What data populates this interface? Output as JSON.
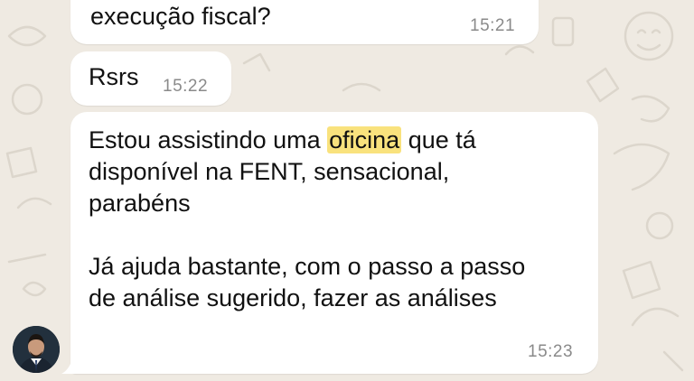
{
  "messages": [
    {
      "text": "execução fiscal?",
      "time": "15:21"
    },
    {
      "text": "Rsrs",
      "time": "15:22"
    },
    {
      "para1_before": "Estou assistindo uma ",
      "para1_highlight": "oficina",
      "para1_line1_after": " que tá",
      "para1_line2": "disponível na FENT, sensacional,",
      "para1_line3": "parabéns",
      "para2_line1": "Já ajuda bastante, com o passo a passo",
      "para2_line2": "de análise sugerido, fazer as análises",
      "time": "15:23"
    }
  ],
  "colors": {
    "background": "#efeae2",
    "bubble": "#ffffff",
    "highlight": "#f9e27d",
    "timestamp": "#8a8a8a"
  }
}
